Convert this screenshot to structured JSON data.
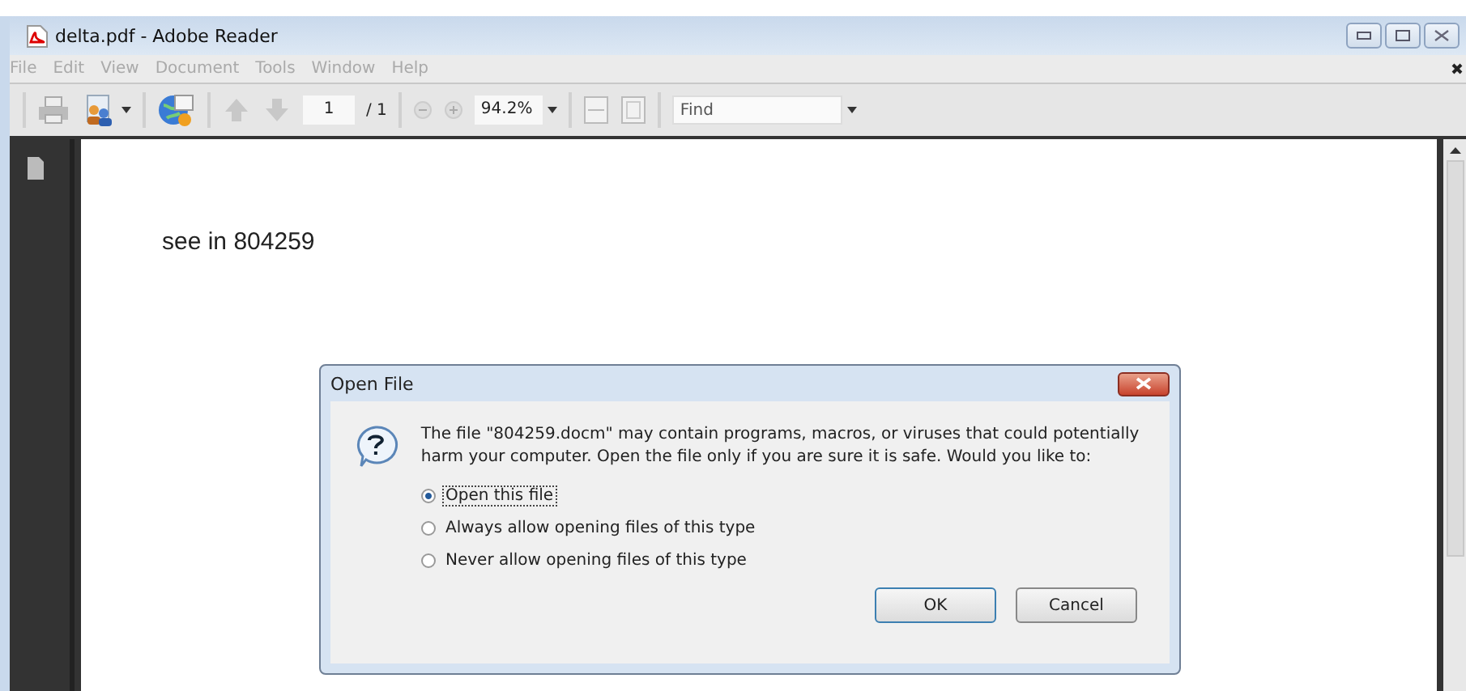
{
  "window": {
    "title": "delta.pdf - Adobe Reader"
  },
  "menu": [
    "File",
    "Edit",
    "View",
    "Document",
    "Tools",
    "Window",
    "Help"
  ],
  "toolbar": {
    "page_field": "1",
    "page_total": "/ 1",
    "zoom_field": "94.2%",
    "find": {
      "placeholder": "Find"
    }
  },
  "document": {
    "text": "see in 804259"
  },
  "dialog": {
    "title": "Open File",
    "message": "The file \"804259.docm\" may contain programs, macros, or viruses that could potentially harm your computer. Open the file only if you are sure it is safe. Would you like to:",
    "options": [
      {
        "label": "Open this file",
        "selected": true
      },
      {
        "label": "Always allow opening files of this type",
        "selected": false
      },
      {
        "label": "Never allow opening files of this type",
        "selected": false
      }
    ],
    "buttons": [
      "OK",
      "Cancel"
    ]
  }
}
